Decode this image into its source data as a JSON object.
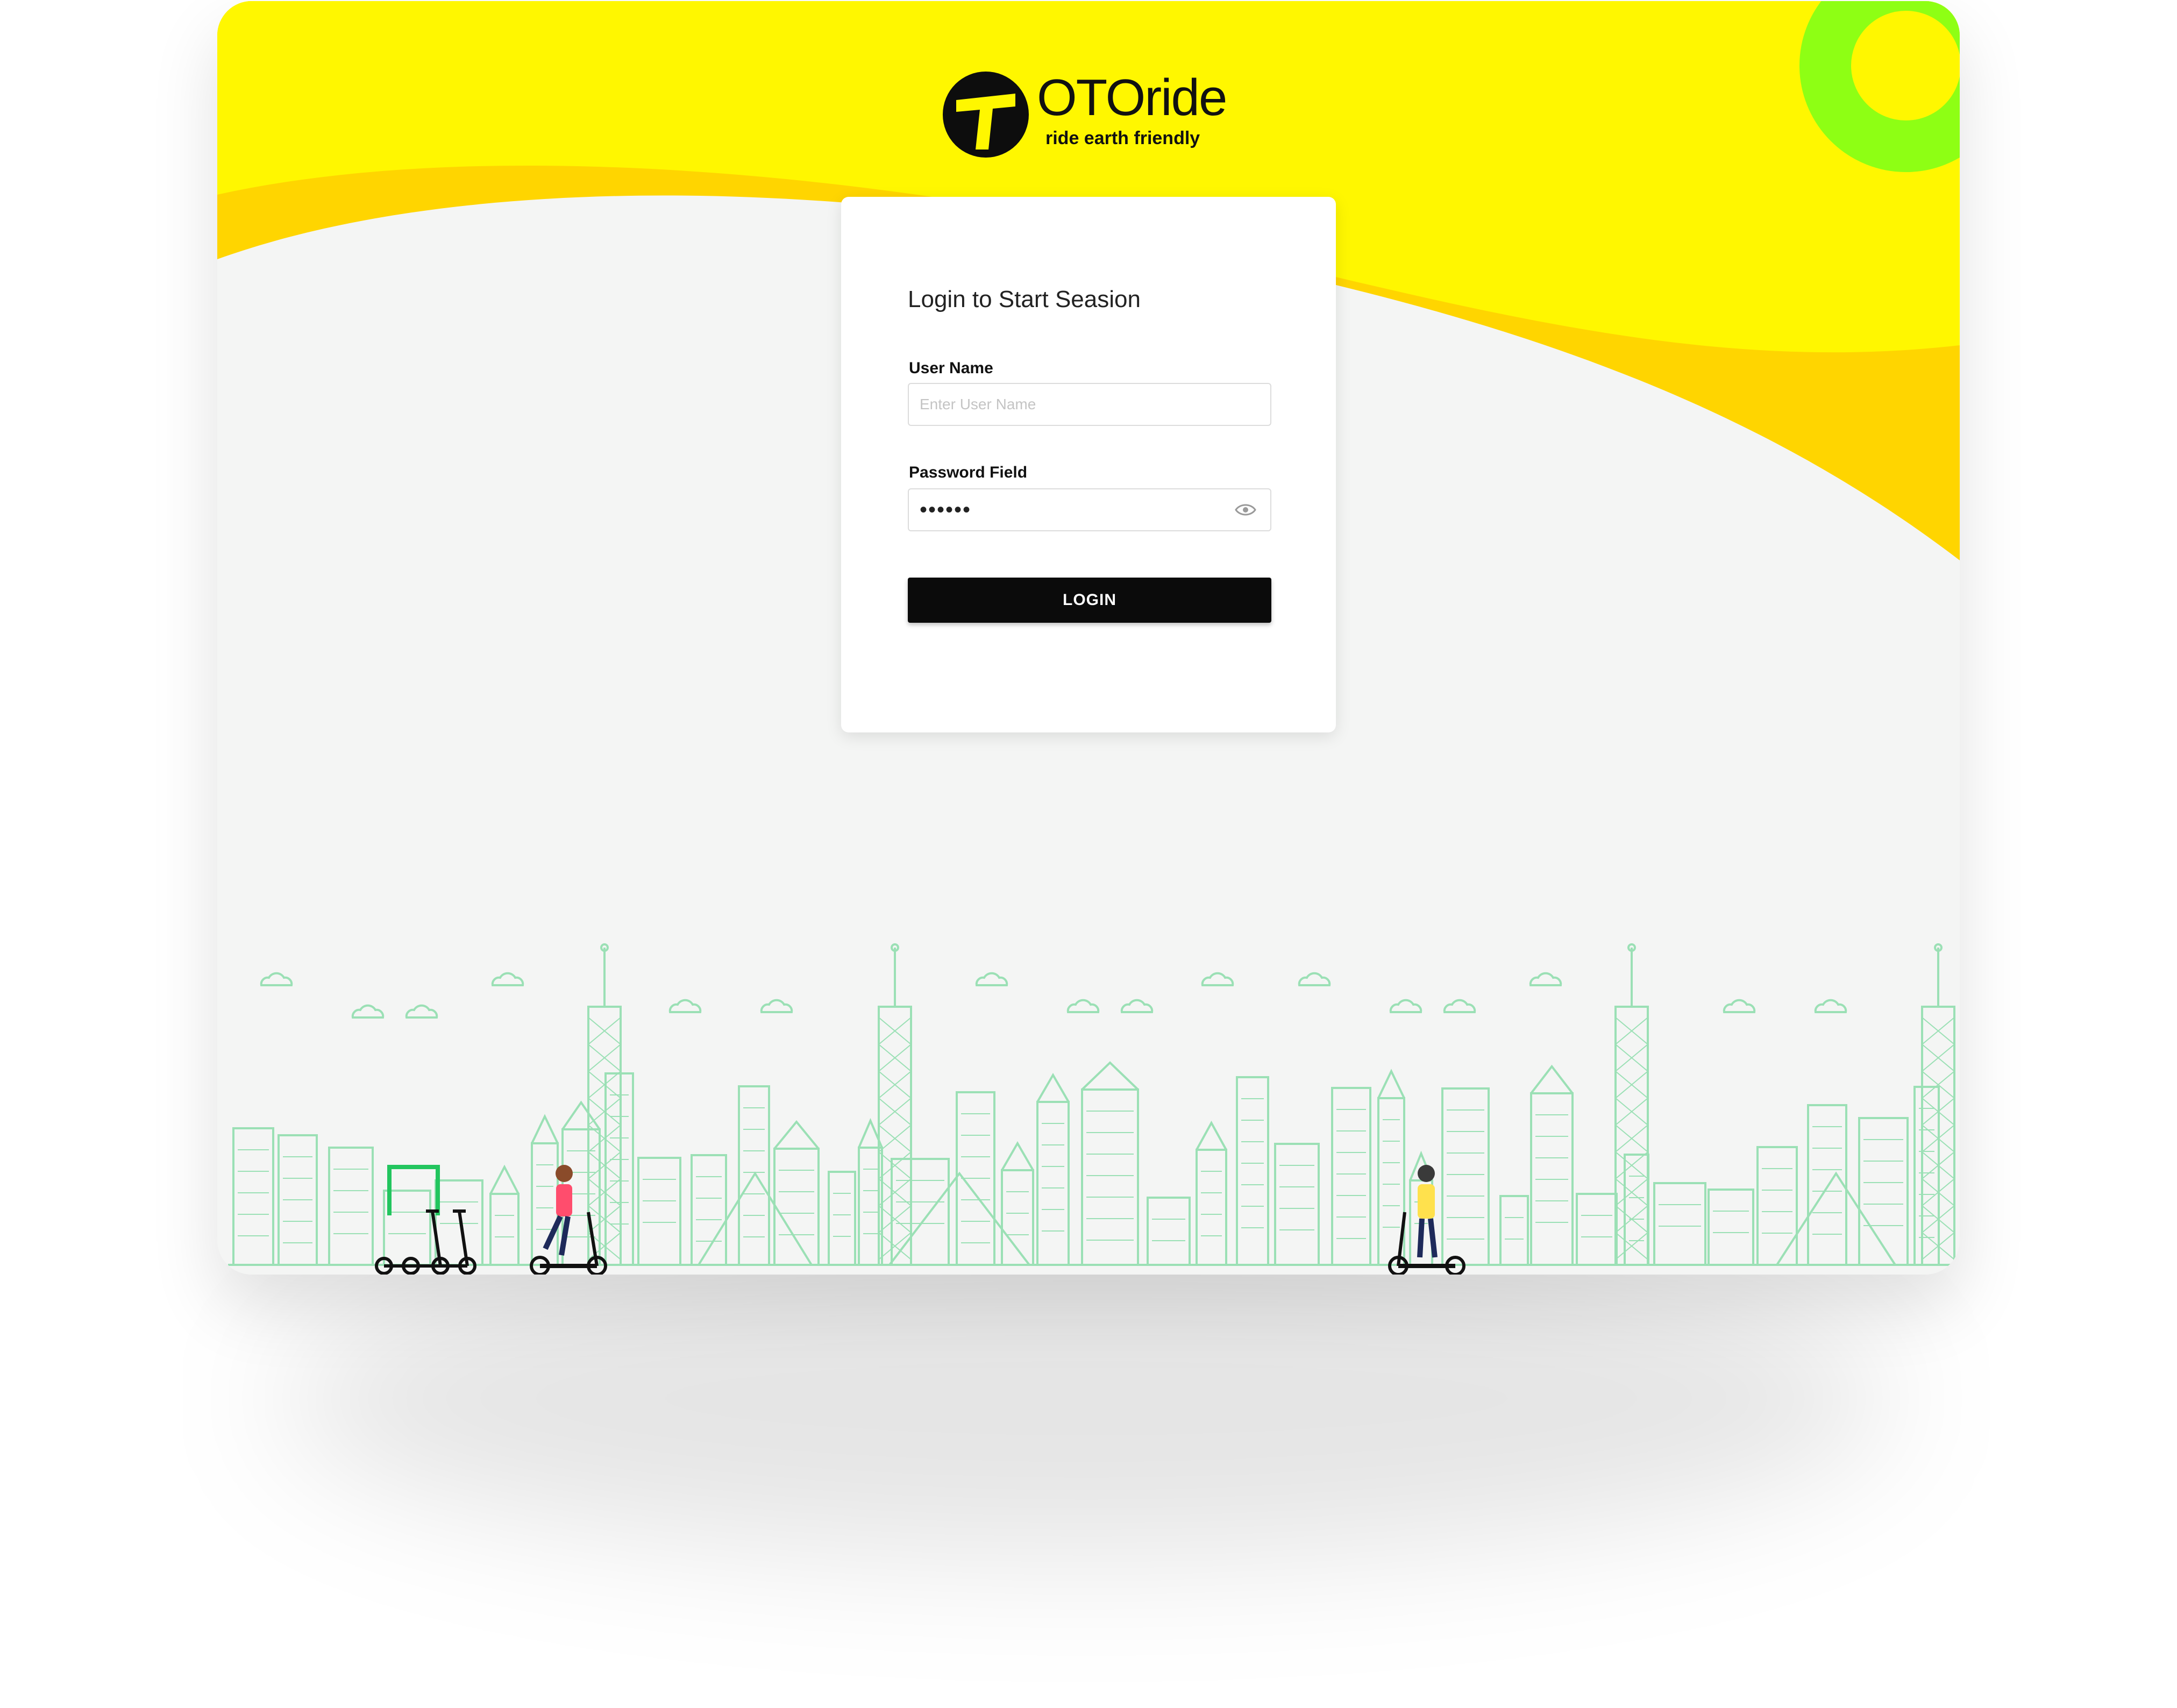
{
  "brand": {
    "wordmark": "OTOride",
    "tagline": "ride earth friendly"
  },
  "login": {
    "title": "Login to Start Seasion",
    "username_label": "User Name",
    "username_placeholder": "Enter User Name",
    "username_value": "",
    "password_label": "Password Field",
    "password_value": "••••••",
    "button_label": "LOGIN"
  },
  "icons": {
    "brand": "otoride-logo-icon",
    "password_toggle": "eye-icon"
  },
  "colors": {
    "yellow": "#FFF700",
    "amber": "#FFD500",
    "lime": "#8EFF14",
    "background": "#F4F5F4",
    "skyline": "#9BE0B5",
    "button": "#0B0B0B"
  }
}
